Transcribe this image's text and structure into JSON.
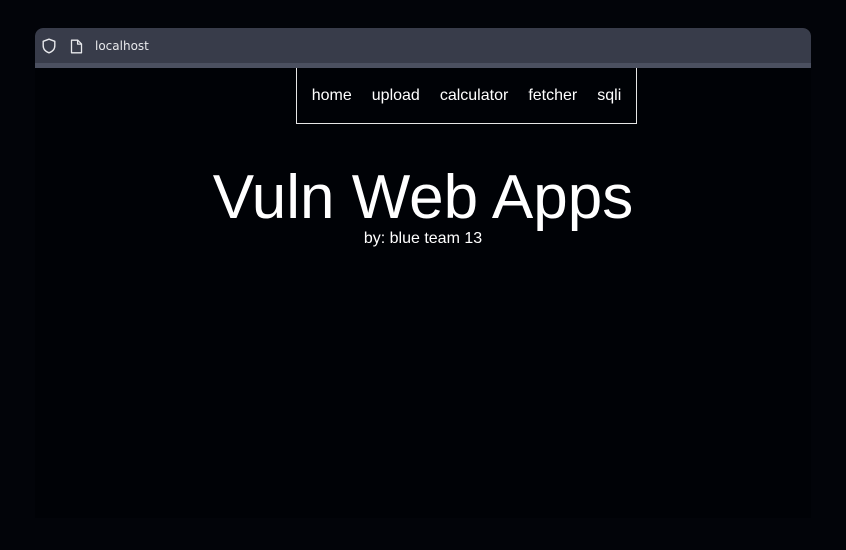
{
  "browser": {
    "url": "localhost"
  },
  "nav": {
    "items": [
      "home",
      "upload",
      "calculator",
      "fetcher",
      "sqli"
    ]
  },
  "page": {
    "title": "Vuln Web Apps",
    "subtitle": "by: blue team 13"
  }
}
